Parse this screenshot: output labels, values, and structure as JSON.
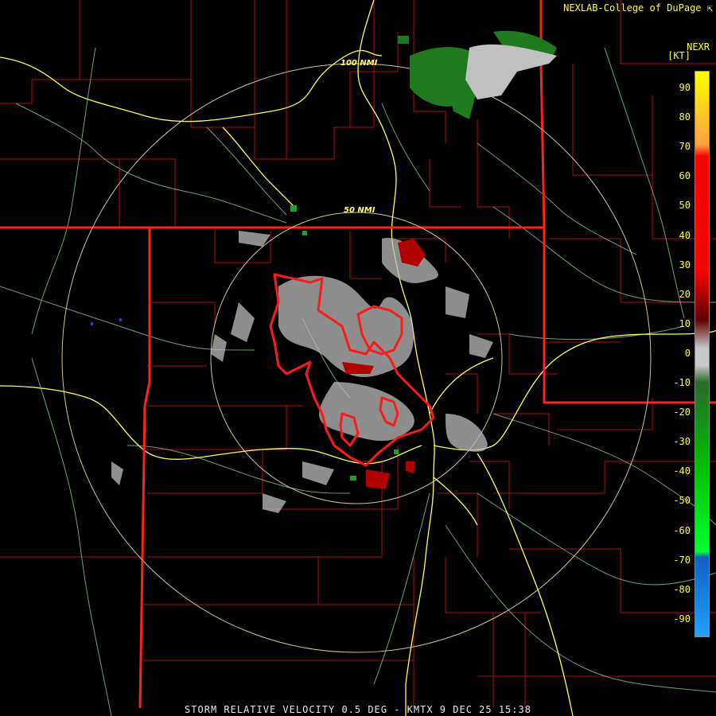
{
  "header": {
    "brand": "NEXLAB-College of DuPage",
    "product": "NEXR",
    "unit": "[KT]"
  },
  "footer": {
    "caption": "STORM RELATIVE VELOCITY 0.5 DEG - KMTX 9 DEC 25 15:38"
  },
  "range_rings": [
    {
      "label": "50 NMI"
    },
    {
      "label": "100 NMI"
    }
  ],
  "colorbar": {
    "ticks": [
      "90",
      "80",
      "70",
      "60",
      "50",
      "40",
      "30",
      "20",
      "10",
      "0",
      "-10",
      "-20",
      "-30",
      "-40",
      "-50",
      "-60",
      "-70",
      "-80",
      "-90"
    ],
    "colors": {
      "top": "#ffff00",
      "orange": "#ffa040",
      "red": "#ff0000",
      "dark_red": "#600000",
      "gray": "#c8c8c8",
      "green": "#00c000",
      "bright_green": "#00ff33",
      "blue": "#1060c0",
      "light_blue": "#20a0ff"
    }
  },
  "map_colors": {
    "state_border": "#ff1a1a",
    "county_border": "#bb1111",
    "highway": "#ffff66",
    "road": "#90c890",
    "ring": "#e8d8a0",
    "warning_polygon": "#ff2020"
  }
}
